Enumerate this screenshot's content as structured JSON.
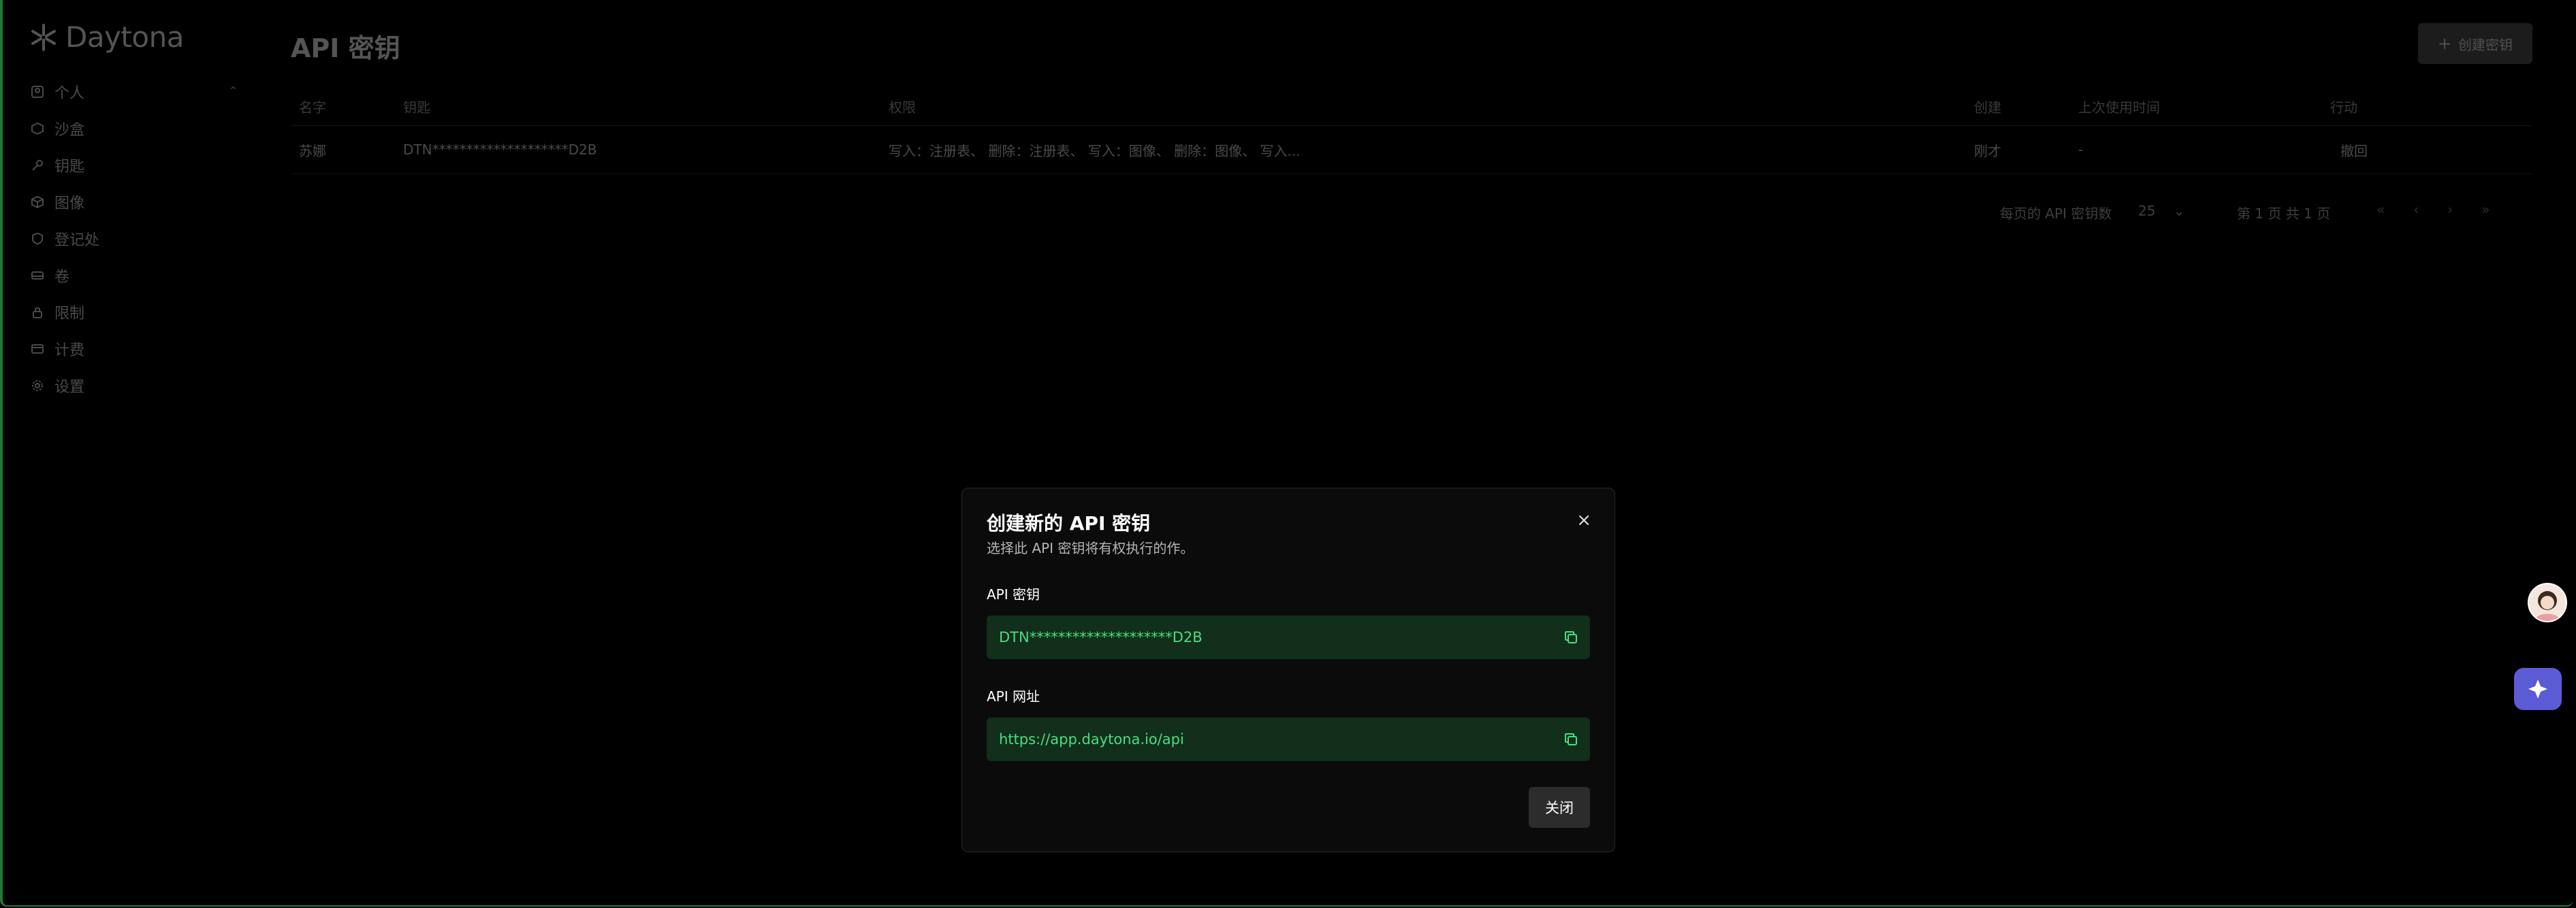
{
  "app": {
    "logo_text": "Daytona",
    "page_title": "API 密钥",
    "create_button": "创建密钥"
  },
  "sidebar": {
    "items": [
      {
        "label": "个人",
        "icon": "user-square-icon"
      },
      {
        "label": "沙盒",
        "icon": "box-icon"
      },
      {
        "label": "钥匙",
        "icon": "key-icon"
      },
      {
        "label": "图像",
        "icon": "package-icon"
      },
      {
        "label": "登记处",
        "icon": "registry-icon"
      },
      {
        "label": "卷",
        "icon": "drive-icon"
      },
      {
        "label": "限制",
        "icon": "lock-icon"
      },
      {
        "label": "计费",
        "icon": "credit-card-icon"
      },
      {
        "label": "设置",
        "icon": "gear-icon"
      }
    ]
  },
  "table": {
    "headers": [
      "名字",
      "钥匙",
      "权限",
      "创建",
      "上次使用时间",
      "行动"
    ],
    "rows": [
      {
        "name": "苏娜",
        "key": "DTN********************D2B",
        "permissions": "写入：注册表、 删除：注册表、 写入：图像、 删除：图像、 写入...",
        "created": "刚才",
        "last_used": "-",
        "action": "撤回"
      }
    ]
  },
  "pagination": {
    "per_page_label": "每页的 API 密钥数",
    "per_page_value": "25",
    "page_info": "第 1 页 共 1 页"
  },
  "modal": {
    "title": "创建新的 API 密钥",
    "description": "选择此 API 密钥将有权执行的作。",
    "api_key_label": "API 密钥",
    "api_key_value": "DTN********************D2B",
    "api_url_label": "API 网址",
    "api_url_value": "https://app.daytona.io/api",
    "close_button": "关闭"
  },
  "colors": {
    "accent_green": "#4ade80",
    "field_bg": "#112f1b",
    "assistant": "#5b5bd6"
  }
}
